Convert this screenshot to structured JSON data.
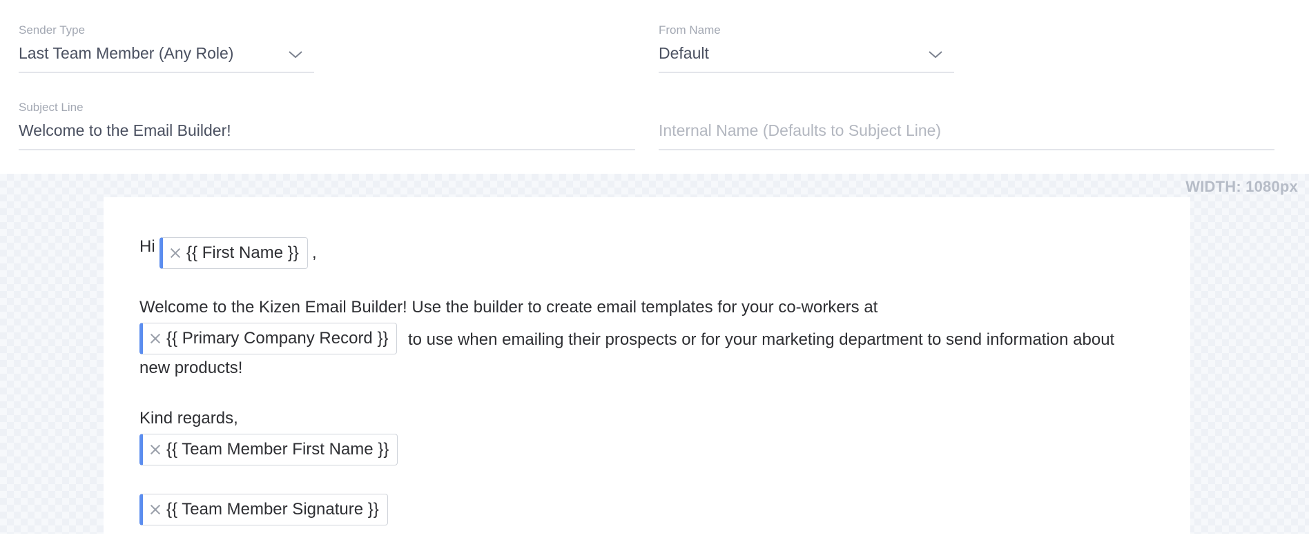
{
  "settings": {
    "sender_type": {
      "label": "Sender Type",
      "value": "Last Team Member (Any Role)"
    },
    "from_name": {
      "label": "From Name",
      "value": "Default"
    },
    "subject_line": {
      "label": "Subject Line",
      "value": "Welcome to the Email Builder!"
    },
    "internal_name": {
      "placeholder": "Internal Name (Defaults to Subject Line)"
    }
  },
  "canvas": {
    "width_label": "WIDTH: 1080px"
  },
  "email": {
    "greeting": "Hi",
    "greeting_comma": ",",
    "chip_first_name": "{{ First Name }}",
    "line1": "Welcome to the Kizen Email Builder! Use the builder to create email templates for your co-workers at",
    "chip_company": "{{ Primary Company Record }}",
    "line2": "to use when emailing their prospects or for your marketing department to send information about",
    "line3": "new products!",
    "closing": "Kind regards,",
    "chip_team_first_name": "{{ Team Member First Name }}",
    "chip_signature": "{{ Team Member Signature }}"
  },
  "colors": {
    "chip_accent": "#5b8def",
    "label": "#a3a8b3",
    "text": "#2e2f33"
  }
}
